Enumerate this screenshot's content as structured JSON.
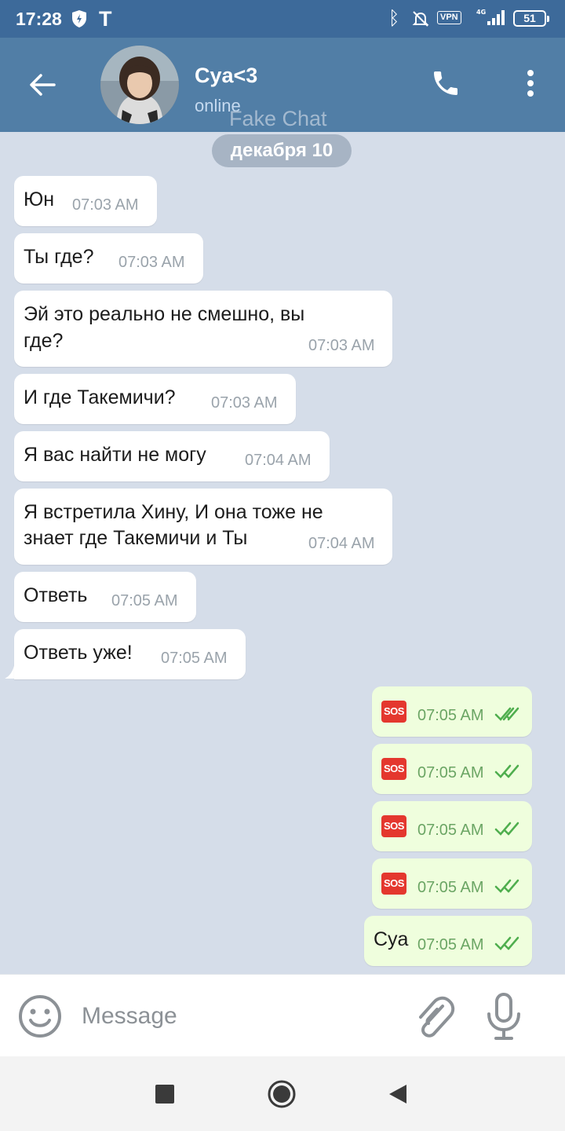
{
  "status_bar": {
    "time": "17:28",
    "vpn_label": "VPN",
    "network_label": "4G",
    "battery": "51"
  },
  "header": {
    "contact_name": "Cya<3",
    "contact_status": "online",
    "back_icon": "back-arrow-icon",
    "call_icon": "phone-icon",
    "menu_icon": "more-vert-icon"
  },
  "watermark": "Fake Chat",
  "date_chip": "декабря 10",
  "messages": [
    {
      "text": "Юн",
      "time": "07:03 AM",
      "direction": "in"
    },
    {
      "text": "Ты где?",
      "time": "07:03 AM",
      "direction": "in"
    },
    {
      "line1": "Эй это реально не смешно, вы",
      "line2": "где?",
      "time": "07:03 AM",
      "direction": "in"
    },
    {
      "text": "И где Такемичи?",
      "time": "07:03 AM",
      "direction": "in"
    },
    {
      "text": "Я вас найти не могу",
      "time": "07:04 AM",
      "direction": "in"
    },
    {
      "line1": "Я встретила Хину, И она тоже не",
      "line2": "знает где Такемичи и Ты",
      "time": "07:04 AM",
      "direction": "in"
    },
    {
      "text": "Ответь",
      "time": "07:05 AM",
      "direction": "in"
    },
    {
      "text": "Ответь уже!",
      "time": "07:05 AM",
      "direction": "in"
    },
    {
      "text": "SOS",
      "time": "07:05 AM",
      "direction": "out",
      "status": "read"
    },
    {
      "text": "SOS",
      "time": "07:05 AM",
      "direction": "out",
      "status": "read"
    },
    {
      "text": "SOS",
      "time": "07:05 AM",
      "direction": "out",
      "status": "read"
    },
    {
      "text": "SOS",
      "time": "07:05 AM",
      "direction": "out",
      "status": "read"
    },
    {
      "text": "Cya",
      "time": "07:05 AM",
      "direction": "out",
      "status": "read"
    }
  ],
  "input_bar": {
    "placeholder": "Message",
    "emoji_icon": "emoji-icon",
    "attach_icon": "paperclip-icon",
    "mic_icon": "microphone-icon"
  },
  "colors": {
    "header": "#517ea6",
    "status_bar": "#3d6a9a",
    "chat_background": "#d5dde9",
    "incoming_bubble": "#ffffff",
    "outgoing_bubble": "#effedd",
    "read_check": "#4fae4e"
  }
}
